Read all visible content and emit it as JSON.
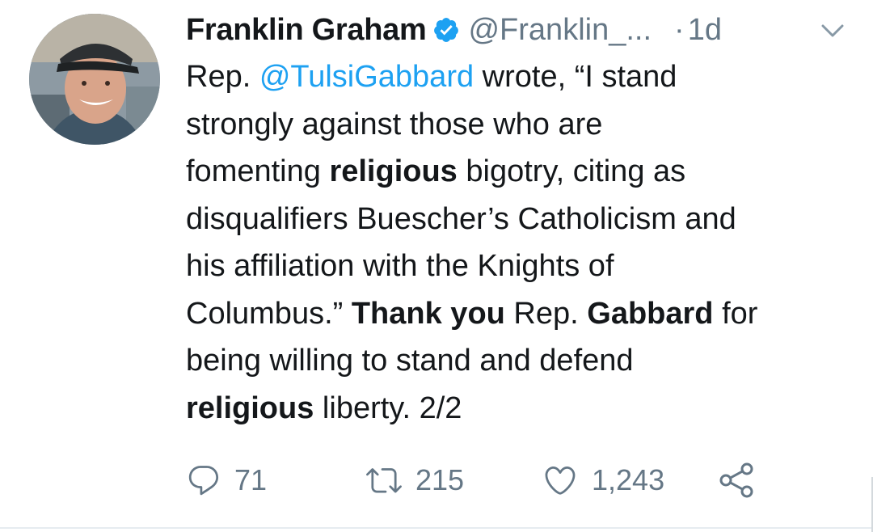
{
  "tweet": {
    "author_name": "Franklin Graham",
    "handle": "@Franklin_...",
    "separator": "·",
    "time": "1d",
    "lines": [
      [
        {
          "t": "Rep. ",
          "s": "n"
        },
        {
          "t": "@TulsiGabbard",
          "s": "m"
        },
        {
          "t": " wrote, “I stand",
          "s": "n"
        }
      ],
      [
        {
          "t": "strongly against those who are",
          "s": "n"
        }
      ],
      [
        {
          "t": "fomenting ",
          "s": "n"
        },
        {
          "t": "religious",
          "s": "b"
        },
        {
          "t": " bigotry, citing as",
          "s": "n"
        }
      ],
      [
        {
          "t": "disqualifiers Buescher’s Catholicism and",
          "s": "n"
        }
      ],
      [
        {
          "t": "his affiliation with the Knights of",
          "s": "n"
        }
      ],
      [
        {
          "t": "Columbus.” ",
          "s": "n"
        },
        {
          "t": "Thank you",
          "s": "b"
        },
        {
          "t": " Rep. ",
          "s": "n"
        },
        {
          "t": "Gabbard",
          "s": "b"
        },
        {
          "t": " for",
          "s": "n"
        }
      ],
      [
        {
          "t": "being willing to stand and defend",
          "s": "n"
        }
      ],
      [
        {
          "t": "religious",
          "s": "b"
        },
        {
          "t": " liberty. 2/2",
          "s": "n"
        }
      ]
    ],
    "actions": {
      "reply_count": "71",
      "retweet_count": "215",
      "like_count": "1,243"
    }
  },
  "colors": {
    "accent": "#1da1f2",
    "muted": "#657786",
    "text": "#14171a"
  },
  "icons": [
    "verified-badge-icon",
    "chevron-down-icon",
    "reply-icon",
    "retweet-icon",
    "like-icon",
    "share-icon"
  ]
}
